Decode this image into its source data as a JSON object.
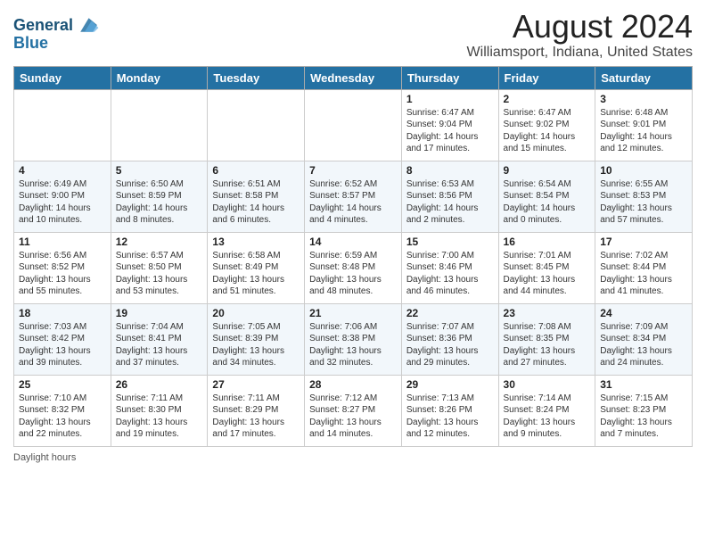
{
  "header": {
    "logo_line1": "General",
    "logo_line2": "Blue",
    "title": "August 2024",
    "subtitle": "Williamsport, Indiana, United States"
  },
  "weekdays": [
    "Sunday",
    "Monday",
    "Tuesday",
    "Wednesday",
    "Thursday",
    "Friday",
    "Saturday"
  ],
  "footer": {
    "label": "Daylight hours"
  },
  "weeks": [
    [
      {
        "day": "",
        "info": ""
      },
      {
        "day": "",
        "info": ""
      },
      {
        "day": "",
        "info": ""
      },
      {
        "day": "",
        "info": ""
      },
      {
        "day": "1",
        "info": "Sunrise: 6:47 AM\nSunset: 9:04 PM\nDaylight: 14 hours\nand 17 minutes."
      },
      {
        "day": "2",
        "info": "Sunrise: 6:47 AM\nSunset: 9:02 PM\nDaylight: 14 hours\nand 15 minutes."
      },
      {
        "day": "3",
        "info": "Sunrise: 6:48 AM\nSunset: 9:01 PM\nDaylight: 14 hours\nand 12 minutes."
      }
    ],
    [
      {
        "day": "4",
        "info": "Sunrise: 6:49 AM\nSunset: 9:00 PM\nDaylight: 14 hours\nand 10 minutes."
      },
      {
        "day": "5",
        "info": "Sunrise: 6:50 AM\nSunset: 8:59 PM\nDaylight: 14 hours\nand 8 minutes."
      },
      {
        "day": "6",
        "info": "Sunrise: 6:51 AM\nSunset: 8:58 PM\nDaylight: 14 hours\nand 6 minutes."
      },
      {
        "day": "7",
        "info": "Sunrise: 6:52 AM\nSunset: 8:57 PM\nDaylight: 14 hours\nand 4 minutes."
      },
      {
        "day": "8",
        "info": "Sunrise: 6:53 AM\nSunset: 8:56 PM\nDaylight: 14 hours\nand 2 minutes."
      },
      {
        "day": "9",
        "info": "Sunrise: 6:54 AM\nSunset: 8:54 PM\nDaylight: 14 hours\nand 0 minutes."
      },
      {
        "day": "10",
        "info": "Sunrise: 6:55 AM\nSunset: 8:53 PM\nDaylight: 13 hours\nand 57 minutes."
      }
    ],
    [
      {
        "day": "11",
        "info": "Sunrise: 6:56 AM\nSunset: 8:52 PM\nDaylight: 13 hours\nand 55 minutes."
      },
      {
        "day": "12",
        "info": "Sunrise: 6:57 AM\nSunset: 8:50 PM\nDaylight: 13 hours\nand 53 minutes."
      },
      {
        "day": "13",
        "info": "Sunrise: 6:58 AM\nSunset: 8:49 PM\nDaylight: 13 hours\nand 51 minutes."
      },
      {
        "day": "14",
        "info": "Sunrise: 6:59 AM\nSunset: 8:48 PM\nDaylight: 13 hours\nand 48 minutes."
      },
      {
        "day": "15",
        "info": "Sunrise: 7:00 AM\nSunset: 8:46 PM\nDaylight: 13 hours\nand 46 minutes."
      },
      {
        "day": "16",
        "info": "Sunrise: 7:01 AM\nSunset: 8:45 PM\nDaylight: 13 hours\nand 44 minutes."
      },
      {
        "day": "17",
        "info": "Sunrise: 7:02 AM\nSunset: 8:44 PM\nDaylight: 13 hours\nand 41 minutes."
      }
    ],
    [
      {
        "day": "18",
        "info": "Sunrise: 7:03 AM\nSunset: 8:42 PM\nDaylight: 13 hours\nand 39 minutes."
      },
      {
        "day": "19",
        "info": "Sunrise: 7:04 AM\nSunset: 8:41 PM\nDaylight: 13 hours\nand 37 minutes."
      },
      {
        "day": "20",
        "info": "Sunrise: 7:05 AM\nSunset: 8:39 PM\nDaylight: 13 hours\nand 34 minutes."
      },
      {
        "day": "21",
        "info": "Sunrise: 7:06 AM\nSunset: 8:38 PM\nDaylight: 13 hours\nand 32 minutes."
      },
      {
        "day": "22",
        "info": "Sunrise: 7:07 AM\nSunset: 8:36 PM\nDaylight: 13 hours\nand 29 minutes."
      },
      {
        "day": "23",
        "info": "Sunrise: 7:08 AM\nSunset: 8:35 PM\nDaylight: 13 hours\nand 27 minutes."
      },
      {
        "day": "24",
        "info": "Sunrise: 7:09 AM\nSunset: 8:34 PM\nDaylight: 13 hours\nand 24 minutes."
      }
    ],
    [
      {
        "day": "25",
        "info": "Sunrise: 7:10 AM\nSunset: 8:32 PM\nDaylight: 13 hours\nand 22 minutes."
      },
      {
        "day": "26",
        "info": "Sunrise: 7:11 AM\nSunset: 8:30 PM\nDaylight: 13 hours\nand 19 minutes."
      },
      {
        "day": "27",
        "info": "Sunrise: 7:11 AM\nSunset: 8:29 PM\nDaylight: 13 hours\nand 17 minutes."
      },
      {
        "day": "28",
        "info": "Sunrise: 7:12 AM\nSunset: 8:27 PM\nDaylight: 13 hours\nand 14 minutes."
      },
      {
        "day": "29",
        "info": "Sunrise: 7:13 AM\nSunset: 8:26 PM\nDaylight: 13 hours\nand 12 minutes."
      },
      {
        "day": "30",
        "info": "Sunrise: 7:14 AM\nSunset: 8:24 PM\nDaylight: 13 hours\nand 9 minutes."
      },
      {
        "day": "31",
        "info": "Sunrise: 7:15 AM\nSunset: 8:23 PM\nDaylight: 13 hours\nand 7 minutes."
      }
    ]
  ]
}
